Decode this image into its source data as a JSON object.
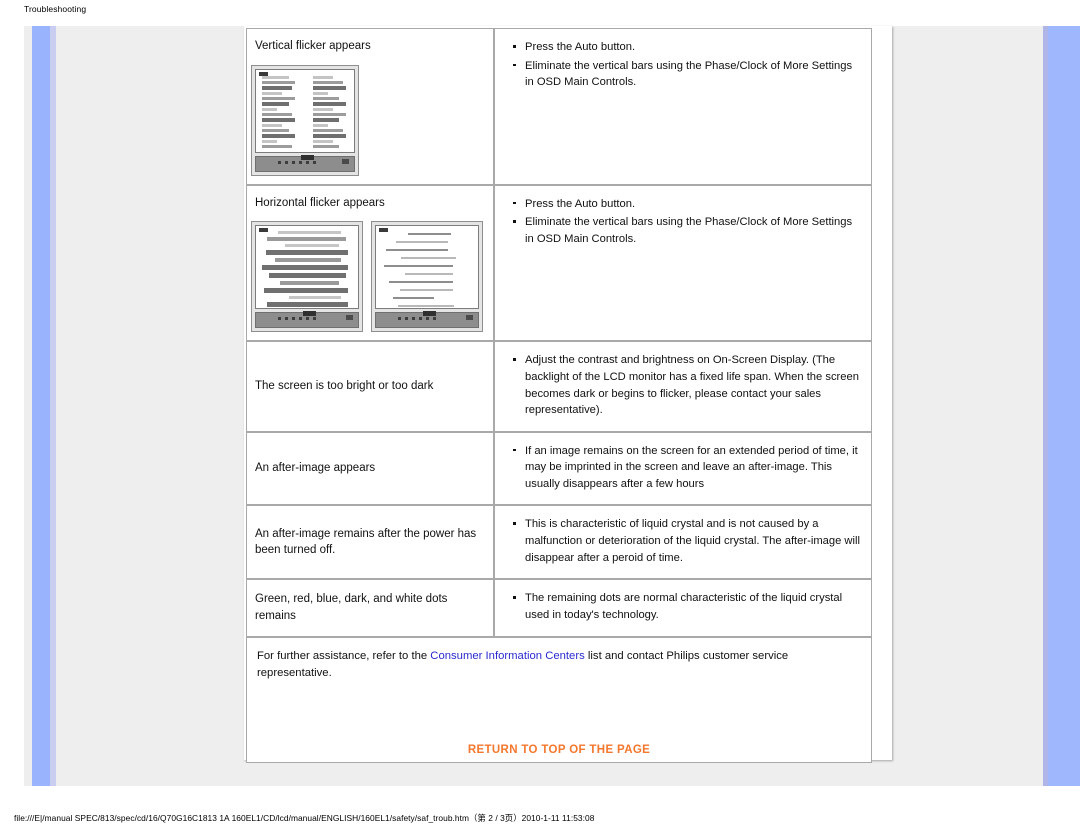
{
  "document": {
    "header_label": "Troubleshooting",
    "status_path": "file:///E|/manual SPEC/813/spec/cd/16/Q70G16C1813 1A 160EL1/CD/lcd/manual/ENGLISH/160EL1/safety/saf_troub.htm（第 2 / 3页）2010-1-11 11:53:08"
  },
  "colors": {
    "rail_blue": "#99b4fc",
    "rail_lavender": "#c9cdef",
    "paper": "#eeeeee",
    "link_blue": "#2a2ad0",
    "return_orange": "#f4772e"
  },
  "table": {
    "rows": [
      {
        "symptom": "Vertical flicker appears",
        "has_image": true,
        "image_kind": "vertical-flicker-monitor-thumbnail",
        "image_count": 1,
        "solutions": [
          "Press the Auto button.",
          "Eliminate the vertical bars using the Phase/Clock of More Settings in OSD Main Controls."
        ]
      },
      {
        "symptom": "Horizontal flicker appears",
        "has_image": true,
        "image_kind": "horizontal-flicker-monitor-thumbnails",
        "image_count": 2,
        "solutions": [
          "Press the Auto button.",
          "Eliminate the vertical bars using the Phase/Clock of More Settings in OSD Main Controls."
        ]
      },
      {
        "symptom": "The screen is too bright or too dark",
        "has_image": false,
        "solutions": [
          "Adjust the contrast and brightness on On-Screen Display. (The backlight of the LCD monitor has a fixed life span. When the screen becomes dark or begins to flicker, please contact your sales representative)."
        ]
      },
      {
        "symptom": "An after-image appears",
        "has_image": false,
        "solutions": [
          "If an image remains on the screen for an extended period of time, it may be imprinted in the screen and leave an after-image. This usually disappears after a few hours"
        ]
      },
      {
        "symptom": "An after-image remains after the power has been turned off.",
        "has_image": false,
        "solutions": [
          "This is characteristic of liquid crystal and is not caused by a malfunction or deterioration of the liquid crystal. The after-image will disappear after a peroid of time."
        ]
      },
      {
        "symptom": "Green, red, blue, dark, and white dots remains",
        "has_image": false,
        "solutions": [
          "The remaining dots are normal characteristic of the liquid crystal used in today's technology."
        ]
      }
    ],
    "footer": {
      "text_before_link": "For further assistance, refer to the ",
      "link_text": "Consumer Information Centers",
      "text_after_link": " list and contact Philips customer service representative.",
      "return_to_top": "RETURN TO TOP OF THE PAGE"
    }
  }
}
